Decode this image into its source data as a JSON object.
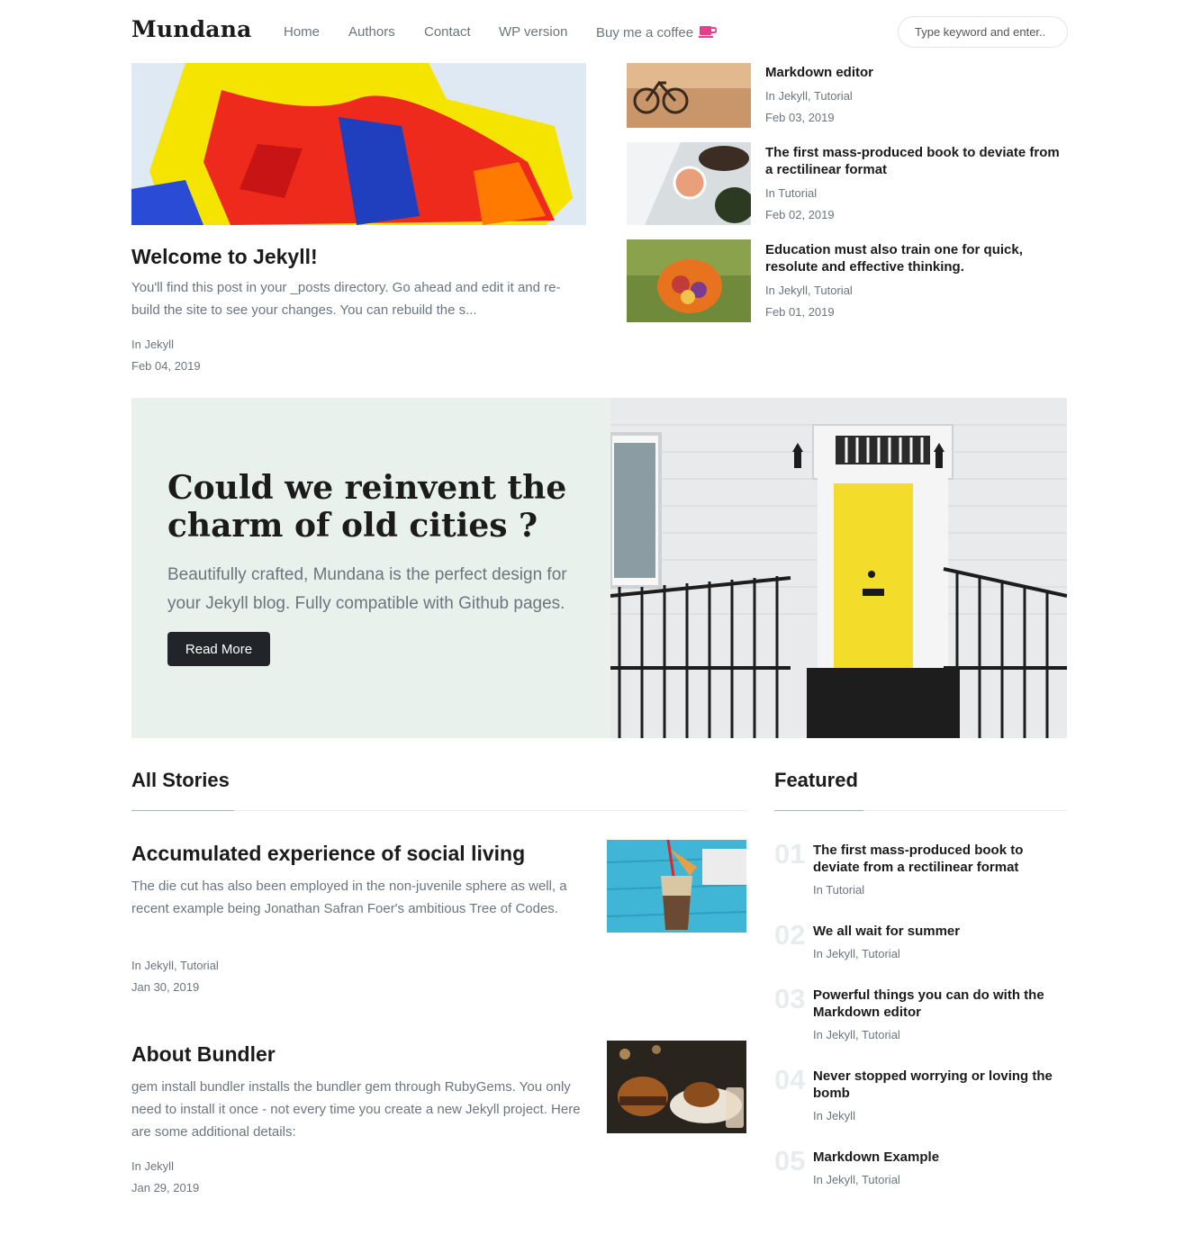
{
  "brand": "Mundana",
  "nav": {
    "home": "Home",
    "authors": "Authors",
    "contact": "Contact",
    "wp": "WP version",
    "coffee": "Buy me a coffee",
    "search_placeholder": "Type keyword and enter.."
  },
  "main_post": {
    "title": "Welcome to Jekyll!",
    "excerpt": "You'll find this post in your _posts directory. Go ahead and edit it and re-build the site to see your changes. You can rebuild the s...",
    "category": "In Jekyll",
    "date": "Feb 04, 2019"
  },
  "side_posts": [
    {
      "title": "Markdown editor",
      "category": "In Jekyll, Tutorial",
      "date": "Feb 03, 2019"
    },
    {
      "title": "The first mass-produced book to deviate from a rectilinear format",
      "category": "In Tutorial",
      "date": "Feb 02, 2019"
    },
    {
      "title": "Education must also train one for quick, resolute and effective thinking.",
      "category": "In Jekyll, Tutorial",
      "date": "Feb 01, 2019"
    }
  ],
  "jumbotron": {
    "title": "Could we reinvent the charm of old cities ?",
    "lead": "Beautifully crafted, Mundana is the perfect design for your Jekyll blog. Fully compatible with Github pages.",
    "button": "Read More"
  },
  "all_stories": {
    "heading": "All Stories",
    "posts": [
      {
        "title": "Accumulated experience of social living",
        "excerpt": "The die cut has also been employed in the non-juvenile sphere as well, a recent example being Jonathan Safran Foer's ambitious Tree of Codes.",
        "category": "In Jekyll, Tutorial",
        "date": "Jan 30, 2019"
      },
      {
        "title": "About Bundler",
        "excerpt": "gem install bundler installs the bundler gem through RubyGems. You only need to install it once - not every time you create a new Jekyll project. Here are some additional details:",
        "category": "In Jekyll",
        "date": "Jan 29, 2019"
      }
    ]
  },
  "featured": {
    "heading": "Featured",
    "items": [
      {
        "num": "01",
        "title": "The first mass-produced book to deviate from a rectilinear format",
        "category": "In Tutorial"
      },
      {
        "num": "02",
        "title": "We all wait for summer",
        "category": "In Jekyll, Tutorial"
      },
      {
        "num": "03",
        "title": "Powerful things you can do with the Markdown editor",
        "category": "In Jekyll, Tutorial"
      },
      {
        "num": "04",
        "title": "Never stopped worrying or loving the bomb",
        "category": "In Jekyll"
      },
      {
        "num": "05",
        "title": "Markdown Example",
        "category": "In Jekyll, Tutorial"
      }
    ]
  },
  "colors": {
    "accent": "#e83e8c",
    "dark": "#212529",
    "muted": "#6c757d",
    "jumbo_bg": "#e8f1ec"
  }
}
